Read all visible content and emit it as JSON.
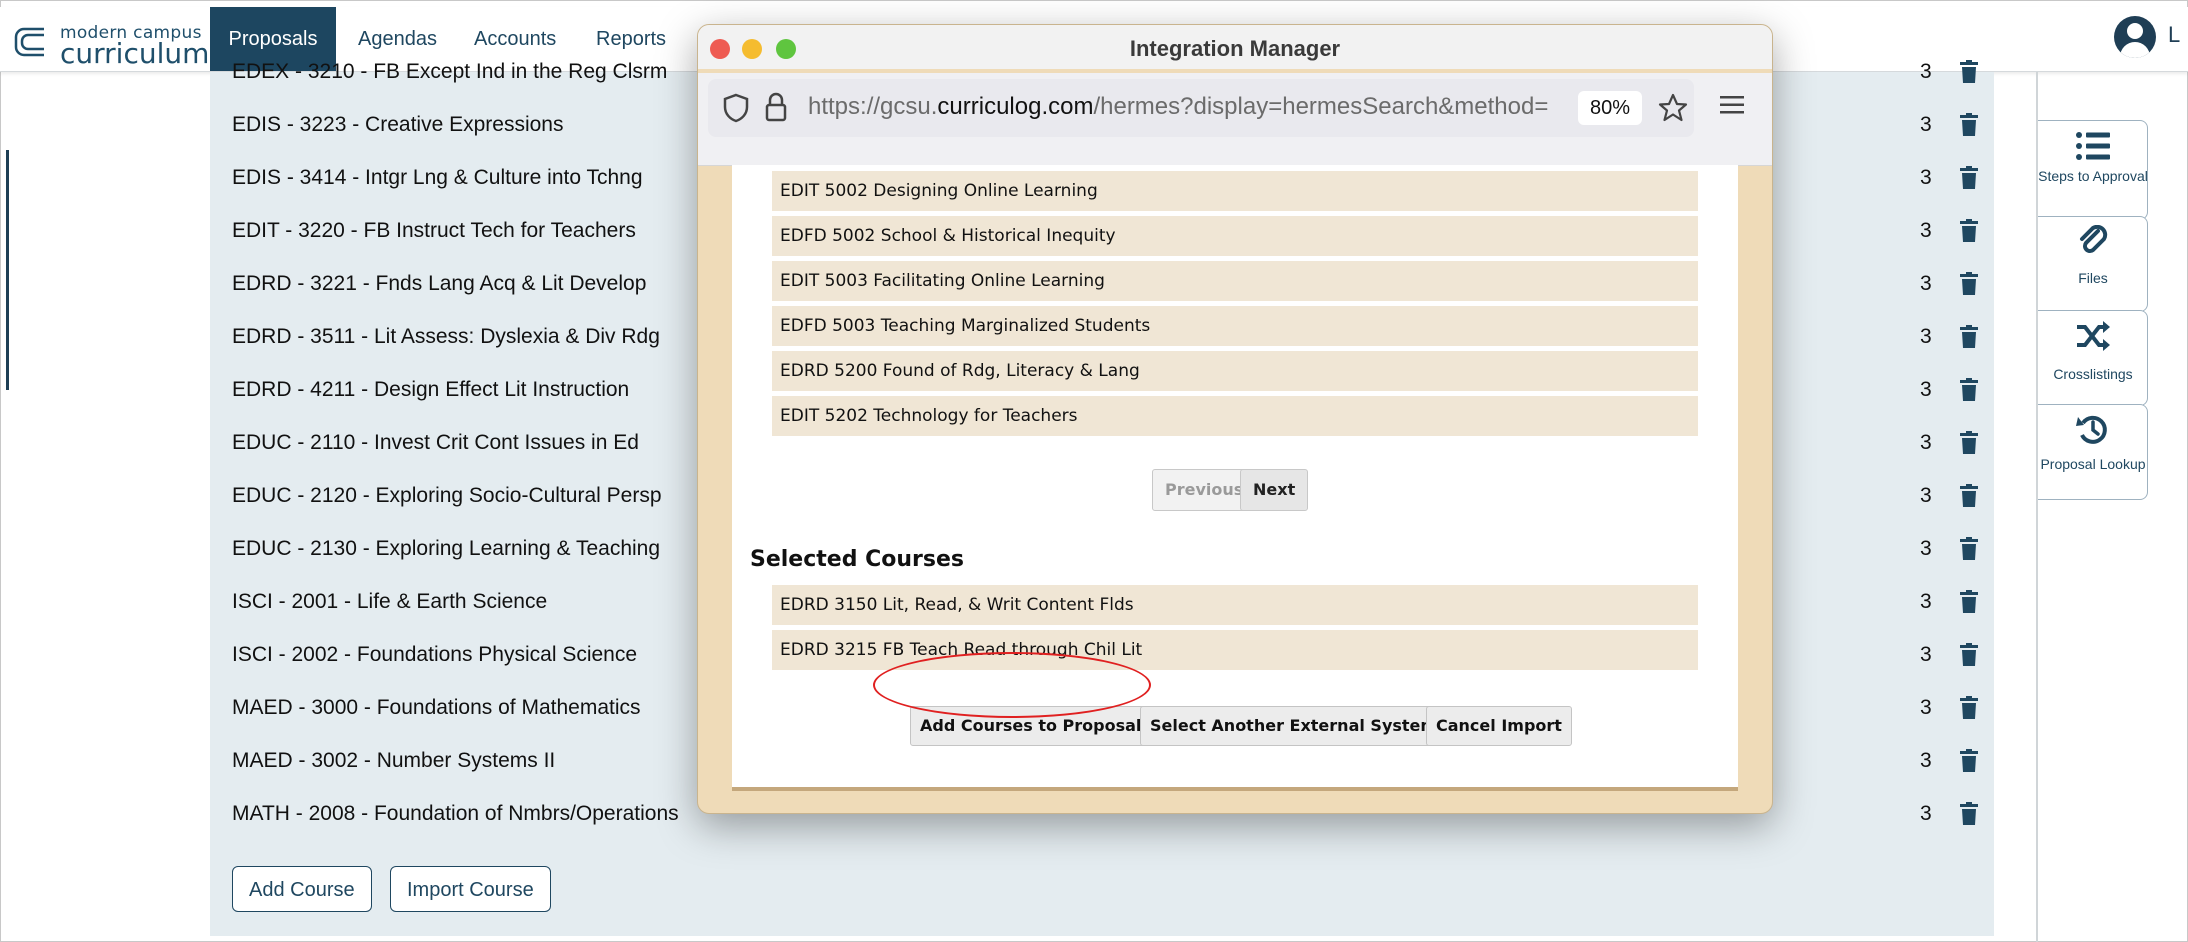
{
  "app": {
    "logo_small": "modern campus",
    "logo_big": "curriculum",
    "nav": [
      {
        "label": "Proposals",
        "active": true
      },
      {
        "label": "Agendas"
      },
      {
        "label": "Accounts"
      },
      {
        "label": "Reports"
      }
    ],
    "profile_label": "L"
  },
  "courses": [
    {
      "label": "EDEX - 3210 - FB Except Ind in the Reg Clsrm",
      "credits": "3"
    },
    {
      "label": "EDIS - 3223 - Creative Expressions",
      "credits": "3"
    },
    {
      "label": "EDIS - 3414 - Intgr Lng & Culture into Tchng",
      "credits": "3"
    },
    {
      "label": "EDIT - 3220 - FB Instruct Tech for Teachers",
      "credits": "3"
    },
    {
      "label": "EDRD - 3221 - Fnds Lang Acq & Lit Develop",
      "credits": "3"
    },
    {
      "label": "EDRD - 3511 - Lit Assess: Dyslexia & Div Rdg",
      "credits": "3"
    },
    {
      "label": "EDRD - 4211 - Design Effect Lit Instruction",
      "credits": "3"
    },
    {
      "label": "EDUC - 2110 - Invest Crit Cont Issues in Ed",
      "credits": "3"
    },
    {
      "label": "EDUC - 2120 - Exploring Socio-Cultural Persp",
      "credits": "3"
    },
    {
      "label": "EDUC - 2130 - Exploring Learning & Teaching",
      "credits": "3"
    },
    {
      "label": "ISCI - 2001 - Life & Earth Science",
      "credits": "3"
    },
    {
      "label": "ISCI - 2002 - Foundations Physical Science",
      "credits": "3"
    },
    {
      "label": "MAED - 3000 - Foundations of Mathematics",
      "credits": "3"
    },
    {
      "label": "MAED - 3002 - Number Systems II",
      "credits": "3"
    },
    {
      "label": "MATH - 2008 - Foundation of Nmbrs/Operations",
      "credits": "3"
    }
  ],
  "buttons": {
    "add_course": "Add Course",
    "import_course": "Import Course"
  },
  "sidebar": [
    {
      "label": "Steps to Approval",
      "icon": "list-icon"
    },
    {
      "label": "Files",
      "icon": "paperclip-icon"
    },
    {
      "label": "Crosslistings",
      "icon": "shuffle-icon"
    },
    {
      "label": "Proposal Lookup",
      "icon": "history-icon"
    }
  ],
  "popup": {
    "title": "Integration Manager",
    "url_prefix": "https://gcsu.",
    "url_domain": "curriculog.com",
    "url_path": "/hermes?display=hermesSearch&method=",
    "zoom": "80%",
    "results": [
      "EDIT 5002 Designing Online Learning",
      "EDFD 5002 School & Historical Inequity",
      "EDIT 5003 Facilitating Online Learning",
      "EDFD 5003 Teaching Marginalized Students",
      "EDRD 5200 Found of Rdg, Literacy & Lang",
      "EDIT 5202 Technology for Teachers"
    ],
    "previous": "Previous",
    "next": "Next",
    "selected_title": "Selected Courses",
    "selected": [
      "EDRD 3150 Lit, Read, & Writ Content Flds",
      "EDRD 3215 FB Teach Read through Chil Lit"
    ],
    "actions": {
      "add": "Add Courses to Proposal",
      "select_other": "Select Another External System",
      "cancel": "Cancel Import"
    }
  },
  "colors": {
    "nav_active": "#1d4660",
    "content_bg": "#e4ecf0",
    "popup_bg": "#efdbb8",
    "row_bg": "#f0e6d5",
    "highlight": "#e02020"
  }
}
